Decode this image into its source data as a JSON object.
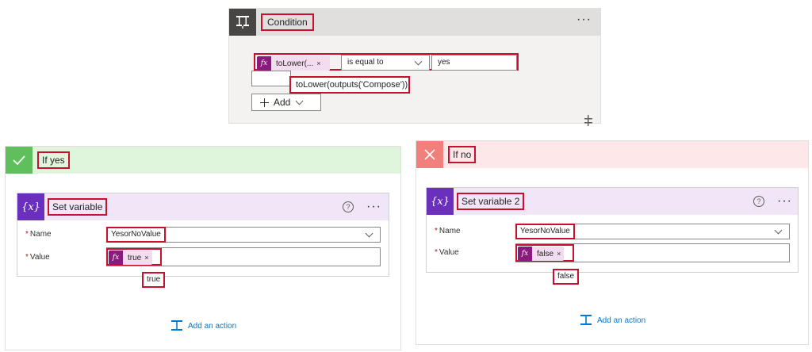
{
  "condition": {
    "title": "Condition",
    "menu": "···",
    "left_operand": {
      "label": "toLower(...",
      "fx": "fx",
      "remove": "×"
    },
    "operator": "is equal to",
    "right_operand": "yes",
    "tooltip": "toLower(outputs('Compose'))",
    "add_label": "Add"
  },
  "branch_yes": {
    "title": "If yes",
    "action": {
      "title": "Set variable",
      "help": "?",
      "menu": "···",
      "name_label": "Name",
      "name_value": "YesorNoValue",
      "value_label": "Value",
      "value_token": "true",
      "fx": "fx",
      "remove": "×",
      "value_preview": "true"
    },
    "add_action": "Add an action"
  },
  "branch_no": {
    "title": "If no",
    "action": {
      "title": "Set variable 2",
      "help": "?",
      "menu": "···",
      "name_label": "Name",
      "name_value": "YesorNoValue",
      "value_label": "Value",
      "value_token": "false",
      "fx": "fx",
      "remove": "×",
      "value_preview": "false"
    },
    "add_action": "Add an action"
  },
  "required_marker": "*",
  "colors": {
    "highlight": "#c8102e",
    "fx_token": "#8b1a7d",
    "variable_icon": "#6b2fbd",
    "yes_header": "#dff6dd",
    "no_header": "#fde7e9",
    "link": "#0078d4"
  }
}
